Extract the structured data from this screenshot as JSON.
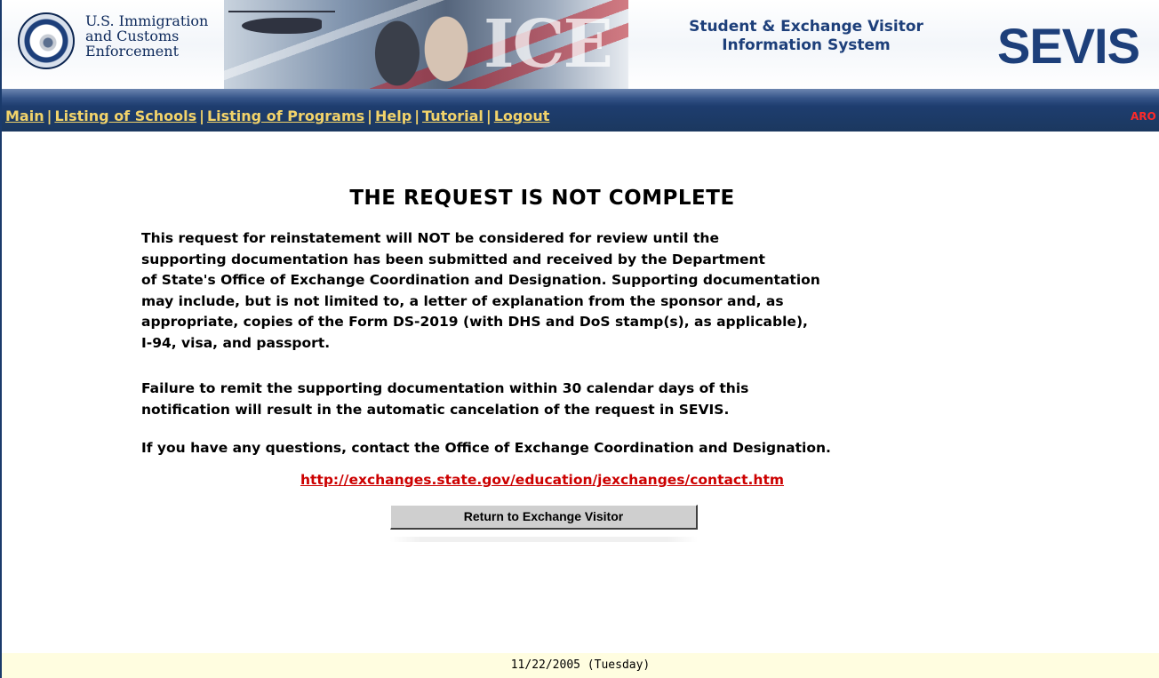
{
  "header": {
    "agency_line1": "U.S. Immigration",
    "agency_line2": "and Customs",
    "agency_line3": "Enforcement",
    "ice_word": "ICE",
    "system_line1": "Student & Exchange Visitor",
    "system_line2": "Information System",
    "system_logo": "SEVIS"
  },
  "nav": {
    "items": [
      {
        "label": "Main"
      },
      {
        "label": "Listing of Schools"
      },
      {
        "label": "Listing of Programs"
      },
      {
        "label": "Help"
      },
      {
        "label": "Tutorial"
      },
      {
        "label": "Logout"
      }
    ],
    "separator": "|",
    "right_text": "ARO"
  },
  "main": {
    "title": "THE REQUEST IS NOT COMPLETE",
    "paragraph1_lines": [
      "This request for reinstatement will NOT be considered for review until the",
      "supporting documentation has been submitted and received by the Department",
      "of State's Office of Exchange Coordination and Designation. Supporting documentation",
      "may include, but is not limited to, a letter of explanation from the sponsor and, as",
      "appropriate, copies of the Form DS-2019 (with DHS and DoS stamp(s), as applicable),",
      "I-94, visa, and passport."
    ],
    "paragraph2_lines": [
      "Failure to remit the supporting documentation within 30 calendar days of this",
      "notification will result in the automatic cancelation of the request in SEVIS."
    ],
    "paragraph3": "If you have any questions, contact the Office of Exchange Coordination and Designation.",
    "contact_link": "http://exchanges.state.gov/education/jexchanges/contact.htm",
    "return_button": "Return to Exchange Visitor"
  },
  "footer": {
    "date": "11/22/2005 (Tuesday)"
  },
  "colors": {
    "nav_background": "#1e3d6f",
    "nav_link": "#f2d36a",
    "link_red": "#cc0000",
    "footer_background": "#fffde0"
  }
}
